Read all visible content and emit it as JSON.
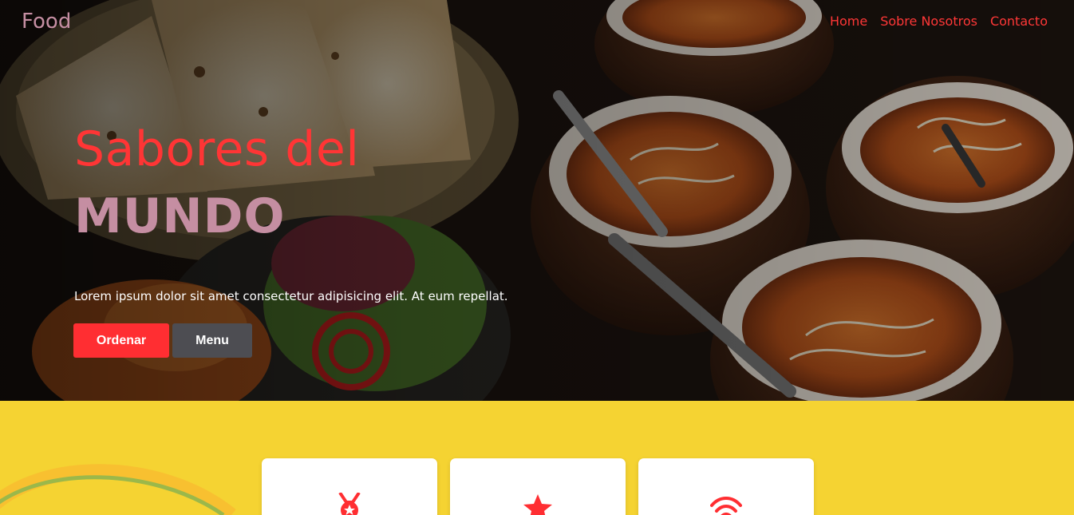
{
  "nav": {
    "logo": "Food",
    "links": [
      "Home",
      "Sobre Nosotros",
      "Contacto"
    ]
  },
  "hero": {
    "title_line1": "Sabores del",
    "title_line2": "MUNDO",
    "description": "Lorem ipsum dolor sit amet consectetur adipisicing elit. At eum repellat.",
    "primary_button": "Ordenar",
    "secondary_button": "Menu"
  },
  "features": {
    "cards": [
      {
        "icon": "medal-icon"
      },
      {
        "icon": "star-icon"
      },
      {
        "icon": "wifi-icon"
      }
    ]
  },
  "colors": {
    "accent": "#ff3535",
    "brand_pink": "#c58ea2",
    "features_bg": "#f5d332",
    "secondary_button": "#4d4d52"
  }
}
